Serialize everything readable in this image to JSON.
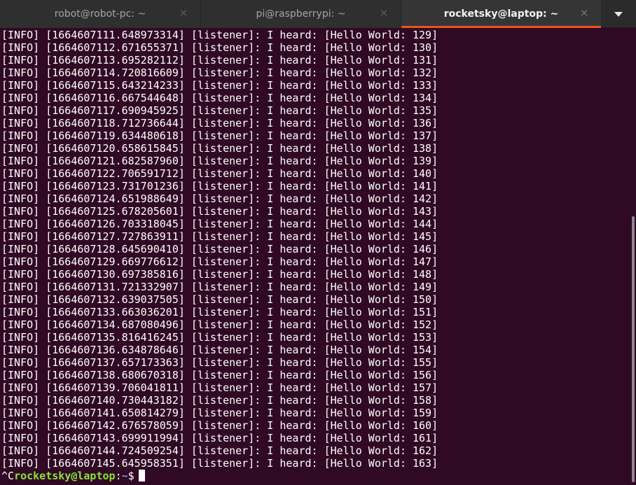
{
  "tabs": [
    {
      "label": "robot@robot-pc: ~",
      "active": false
    },
    {
      "label": "pi@raspberrypi: ~",
      "active": false
    },
    {
      "label": "rocketsky@laptop: ~",
      "active": true
    }
  ],
  "tab_close_glyph": "×",
  "icons": {
    "tab_close": "close-icon",
    "tab_menu": "chevron-down-icon"
  },
  "colors": {
    "background": "#300a24",
    "text": "#ffffff",
    "prompt_user": "#8ae234",
    "prompt_path": "#729fcf",
    "active_tab_accent": "#e95420"
  },
  "log_lines": [
    "[INFO] [1664607111.648973314] [listener]: I heard: [Hello World: 129]",
    "[INFO] [1664607112.671655371] [listener]: I heard: [Hello World: 130]",
    "[INFO] [1664607113.695282112] [listener]: I heard: [Hello World: 131]",
    "[INFO] [1664607114.720816609] [listener]: I heard: [Hello World: 132]",
    "[INFO] [1664607115.643214233] [listener]: I heard: [Hello World: 133]",
    "[INFO] [1664607116.667544648] [listener]: I heard: [Hello World: 134]",
    "[INFO] [1664607117.690945925] [listener]: I heard: [Hello World: 135]",
    "[INFO] [1664607118.712736644] [listener]: I heard: [Hello World: 136]",
    "[INFO] [1664607119.634480618] [listener]: I heard: [Hello World: 137]",
    "[INFO] [1664607120.658615845] [listener]: I heard: [Hello World: 138]",
    "[INFO] [1664607121.682587960] [listener]: I heard: [Hello World: 139]",
    "[INFO] [1664607122.706591712] [listener]: I heard: [Hello World: 140]",
    "[INFO] [1664607123.731701236] [listener]: I heard: [Hello World: 141]",
    "[INFO] [1664607124.651988649] [listener]: I heard: [Hello World: 142]",
    "[INFO] [1664607125.678205601] [listener]: I heard: [Hello World: 143]",
    "[INFO] [1664607126.703318045] [listener]: I heard: [Hello World: 144]",
    "[INFO] [1664607127.727863911] [listener]: I heard: [Hello World: 145]",
    "[INFO] [1664607128.645690410] [listener]: I heard: [Hello World: 146]",
    "[INFO] [1664607129.669776612] [listener]: I heard: [Hello World: 147]",
    "[INFO] [1664607130.697385816] [listener]: I heard: [Hello World: 148]",
    "[INFO] [1664607131.721332907] [listener]: I heard: [Hello World: 149]",
    "[INFO] [1664607132.639037505] [listener]: I heard: [Hello World: 150]",
    "[INFO] [1664607133.663036201] [listener]: I heard: [Hello World: 151]",
    "[INFO] [1664607134.687080496] [listener]: I heard: [Hello World: 152]",
    "[INFO] [1664607135.816416245] [listener]: I heard: [Hello World: 153]",
    "[INFO] [1664607136.634878646] [listener]: I heard: [Hello World: 154]",
    "[INFO] [1664607137.657173363] [listener]: I heard: [Hello World: 155]",
    "[INFO] [1664607138.680670318] [listener]: I heard: [Hello World: 156]",
    "[INFO] [1664607139.706041811] [listener]: I heard: [Hello World: 157]",
    "[INFO] [1664607140.730443182] [listener]: I heard: [Hello World: 158]",
    "[INFO] [1664607141.650814279] [listener]: I heard: [Hello World: 159]",
    "[INFO] [1664607142.676578059] [listener]: I heard: [Hello World: 160]",
    "[INFO] [1664607143.699911994] [listener]: I heard: [Hello World: 161]",
    "[INFO] [1664607144.724509254] [listener]: I heard: [Hello World: 162]",
    "[INFO] [1664607145.645958351] [listener]: I heard: [Hello World: 163]"
  ],
  "prompt": {
    "interrupt": "^C",
    "user_host": "rocketsky@laptop",
    "separator": ":",
    "path": "~",
    "symbol": "$"
  }
}
